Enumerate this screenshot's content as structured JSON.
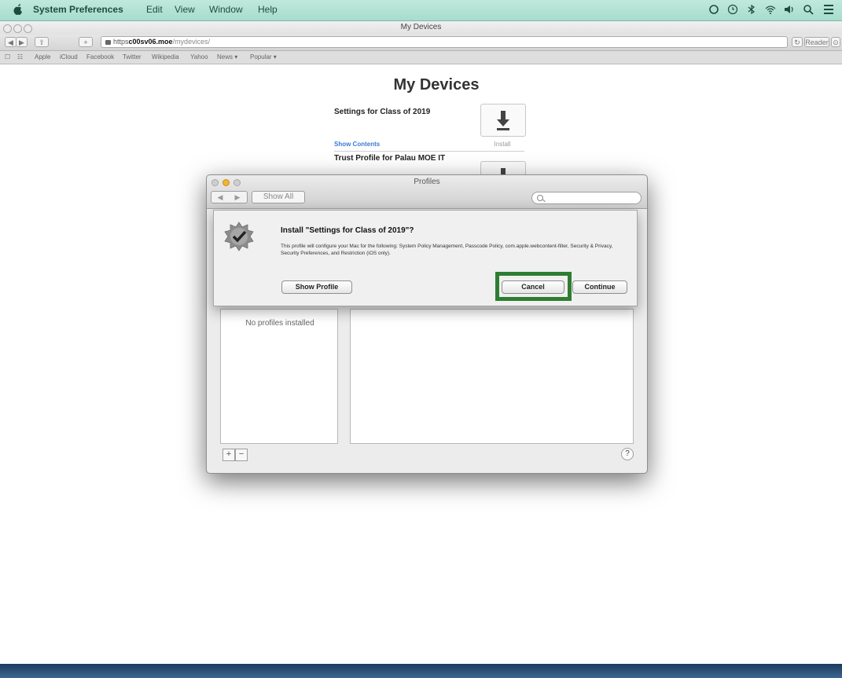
{
  "menubar": {
    "app_name": "System Preferences",
    "items": [
      "Edit",
      "View",
      "Window",
      "Help"
    ]
  },
  "browser": {
    "window_title": "My Devices",
    "url": {
      "scheme": "https",
      "domain": "c00sv06.moe",
      "path": "/mydevices/"
    },
    "reader_label": "Reader",
    "bookmarks": [
      "Apple",
      "iCloud",
      "Facebook",
      "Twitter",
      "Wikipedia",
      "Yahoo",
      "News ▾",
      "Popular ▾"
    ]
  },
  "page": {
    "title": "My Devices",
    "devices": [
      {
        "name": "Settings for Class of 2019",
        "link": "Show Contents",
        "action": "Install"
      },
      {
        "name": "Trust Profile for Palau MOE IT"
      }
    ]
  },
  "prefs": {
    "title": "Profiles",
    "show_all": "Show All",
    "no_profiles": "No profiles installed",
    "add": "+",
    "remove": "−",
    "help": "?"
  },
  "sheet": {
    "title": "Install \"Settings for Class of 2019\"?",
    "message": "This profile will configure your Mac for the following: System Policy Management, Passcode Policy, com.apple.webcontent-filter, Security & Privacy, Security Preferences, and Restriction (iOS only).",
    "show_profile": "Show Profile",
    "cancel": "Cancel",
    "continue": "Continue"
  },
  "highlight_color": "#2e7d32"
}
